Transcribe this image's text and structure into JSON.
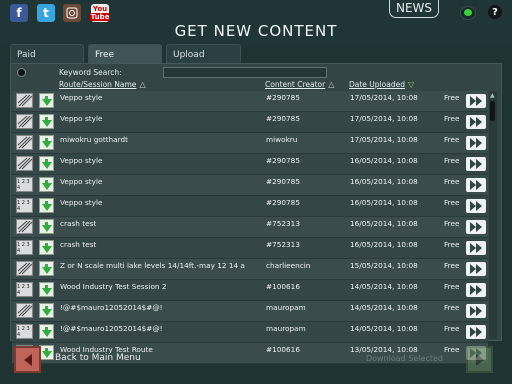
{
  "social": {
    "facebook": "f",
    "twitter": "t",
    "youtube_top": "You",
    "youtube_bottom": "Tube"
  },
  "header": {
    "news_label": "NEWS",
    "help_label": "?",
    "title": "GET NEW CONTENT"
  },
  "tabs": [
    {
      "label": "Paid"
    },
    {
      "label": "Free"
    },
    {
      "label": "Upload"
    }
  ],
  "filters": {
    "keyword_label": "Keyword Search:",
    "keyword_value": ""
  },
  "columns": {
    "route": "Route/Session Name",
    "creator": "Content Creator",
    "date": "Date Uploaded"
  },
  "rows": [
    {
      "type": "route",
      "name": "Veppo style",
      "creator": "#290785",
      "date": "17/05/2014, 10:08",
      "price": "Free"
    },
    {
      "type": "route",
      "name": "Veppo style",
      "creator": "#290785",
      "date": "17/05/2014, 10:08",
      "price": "Free"
    },
    {
      "type": "route",
      "name": "miwokru gotthardt",
      "creator": "miwokru",
      "date": "17/05/2014, 10:08",
      "price": "Free"
    },
    {
      "type": "route",
      "name": "Veppo style",
      "creator": "#290785",
      "date": "16/05/2014, 10:08",
      "price": "Free"
    },
    {
      "type": "session",
      "name": "Veppo style",
      "creator": "#290785",
      "date": "16/05/2014, 10:08",
      "price": "Free"
    },
    {
      "type": "session",
      "name": "Veppo style",
      "creator": "#290785",
      "date": "16/05/2014, 10:08",
      "price": "Free"
    },
    {
      "type": "route",
      "name": "crash test",
      "creator": "#752313",
      "date": "16/05/2014, 10:08",
      "price": "Free"
    },
    {
      "type": "session",
      "name": "crash test",
      "creator": "#752313",
      "date": "16/05/2014, 10:08",
      "price": "Free"
    },
    {
      "type": "route",
      "name": "Z or N scale multi lake levels 14/14ft.-may 12 14 a",
      "creator": "charlieencin",
      "date": "15/05/2014, 10:08",
      "price": "Free"
    },
    {
      "type": "session",
      "name": "Wood Industry Test Session 2",
      "creator": "#100616",
      "date": "14/05/2014, 10:08",
      "price": "Free"
    },
    {
      "type": "route",
      "name": "!@#$mauro12052014$#@!",
      "creator": "mauropam",
      "date": "14/05/2014, 10:08",
      "price": "Free"
    },
    {
      "type": "session",
      "name": "!@#$mauro12052014$#@!",
      "creator": "mauropam",
      "date": "14/05/2014, 10:08",
      "price": "Free"
    },
    {
      "type": "route",
      "name": "Wood Industry Test Route",
      "creator": "#100616",
      "date": "13/05/2014, 10:08",
      "price": "Free"
    }
  ],
  "footer": {
    "back_label": "Back to Main Menu",
    "download_label": "Download Selected"
  }
}
